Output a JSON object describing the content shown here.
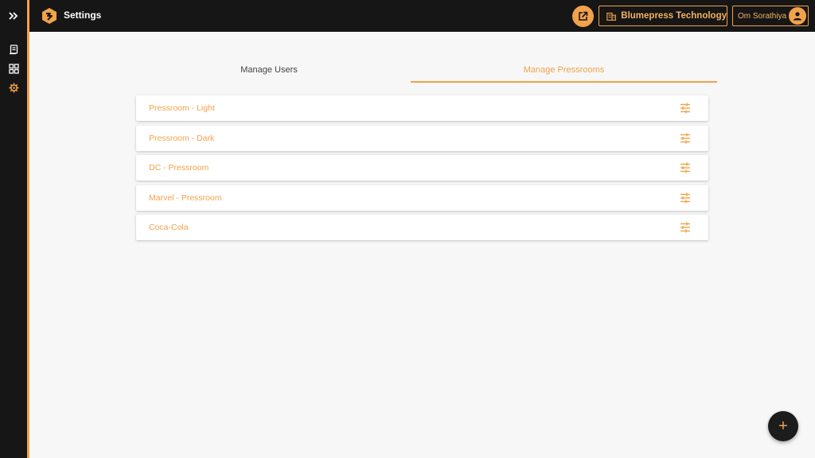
{
  "app": {
    "title": "Settings"
  },
  "header": {
    "organization": "Blumepress Technology",
    "user": "Om Sorathiya"
  },
  "tabs": [
    {
      "label": "Manage Users",
      "active": false
    },
    {
      "label": "Manage Pressrooms",
      "active": true
    }
  ],
  "pressrooms": [
    {
      "name": "Pressroom - Light"
    },
    {
      "name": "Pressroom - Dark"
    },
    {
      "name": "DC - Pressroom"
    },
    {
      "name": "Marvel - Pressroom"
    },
    {
      "name": "Coca-Cola"
    }
  ],
  "sidebar": {
    "items": [
      {
        "icon": "expand-icon"
      },
      {
        "icon": "document-icon"
      },
      {
        "icon": "dashboard-icon"
      },
      {
        "icon": "gear-icon",
        "active": true
      }
    ]
  },
  "fab": {
    "label": "+"
  },
  "colors": {
    "accent": "#f2a24a",
    "dark": "#161616",
    "background": "#f7f7f7"
  }
}
